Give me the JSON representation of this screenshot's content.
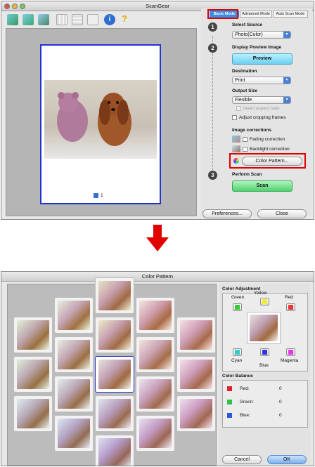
{
  "scangear": {
    "title": "ScanGear",
    "tabs": [
      {
        "label": "Basic Mode",
        "active": true
      },
      {
        "label": "Advanced Mode",
        "active": false
      },
      {
        "label": "Auto Scan Mode",
        "active": false
      }
    ],
    "steps": {
      "select_source": {
        "num": "1",
        "title": "Select Source",
        "value": "Photo(Color)"
      },
      "display_preview": {
        "num": "2",
        "title": "Display Preview Image",
        "button": "Preview"
      },
      "destination": {
        "title": "Destination",
        "value": "Print"
      },
      "output_size": {
        "title": "Output Size",
        "value": "Flexible",
        "invert_label": "Invert aspect ratio"
      },
      "adjust_cropping": {
        "label": "Adjust cropping frames"
      },
      "image_corrections": {
        "title": "Image corrections",
        "fading": "Fading correction",
        "backlight": "Backlight correction",
        "color_pattern_button": "Color Pattern..."
      },
      "perform_scan": {
        "num": "3",
        "title": "Perform Scan",
        "button": "Scan"
      }
    },
    "preview_checkbox_label": "1",
    "footer": {
      "preferences": "Preferences...",
      "close": "Close"
    }
  },
  "color_pattern": {
    "title": "Color Pattern",
    "color_adjustment": {
      "title": "Color Adjustment",
      "green": "Green",
      "yellow": "Yellow",
      "red": "Red",
      "cyan": "Cyan",
      "blue": "Blue",
      "magenta": "Magenta"
    },
    "color_balance": {
      "title": "Color Balance",
      "rows": [
        {
          "label": "Red:",
          "value": "0",
          "color": "#e0202a"
        },
        {
          "label": "Green:",
          "value": "0",
          "color": "#2ec44a"
        },
        {
          "label": "Blue:",
          "value": "0",
          "color": "#2a58d8"
        }
      ]
    },
    "buttons": {
      "cancel": "Cancel",
      "ok": "OK"
    }
  },
  "colors": {
    "accent": "#3a8ee6",
    "scan_green": "#5ed67a",
    "highlight": "#e10000",
    "selected_frame": "#2233cc"
  }
}
